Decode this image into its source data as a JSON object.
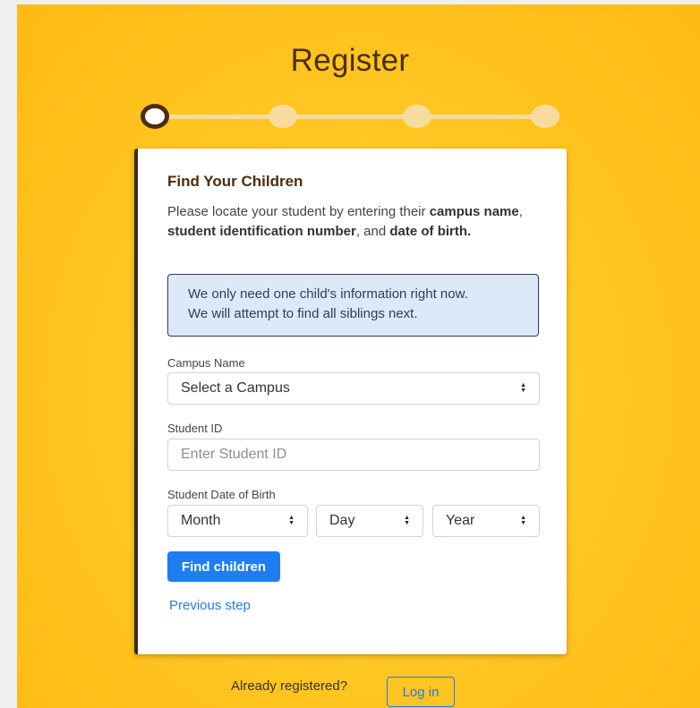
{
  "page": {
    "title": "Register"
  },
  "progress": {
    "current_step": 1,
    "total_steps": 4
  },
  "card": {
    "title": "Find Your Children",
    "desc_prefix": "Please locate your student by entering their ",
    "desc_campus": "campus name",
    "desc_sep1": ", ",
    "desc_sid": "student identification number",
    "desc_sep2": ", and ",
    "desc_dob": "date of birth.",
    "info_line1": "We only need one child's information right now.",
    "info_line2": "We will attempt to find all siblings next."
  },
  "form": {
    "campus_label": "Campus Name",
    "campus_value": "Select a Campus",
    "student_id_label": "Student ID",
    "student_id_placeholder": "Enter Student ID",
    "dob_label": "Student Date of Birth",
    "month_value": "Month",
    "day_value": "Day",
    "year_value": "Year",
    "submit_label": "Find children",
    "previous_label": "Previous step"
  },
  "footer": {
    "already_text": "Already registered?",
    "login_label": "Log in"
  },
  "colors": {
    "accent": "#1f7df3",
    "brand_dark": "#4a2d12",
    "background": "#ffc520"
  }
}
